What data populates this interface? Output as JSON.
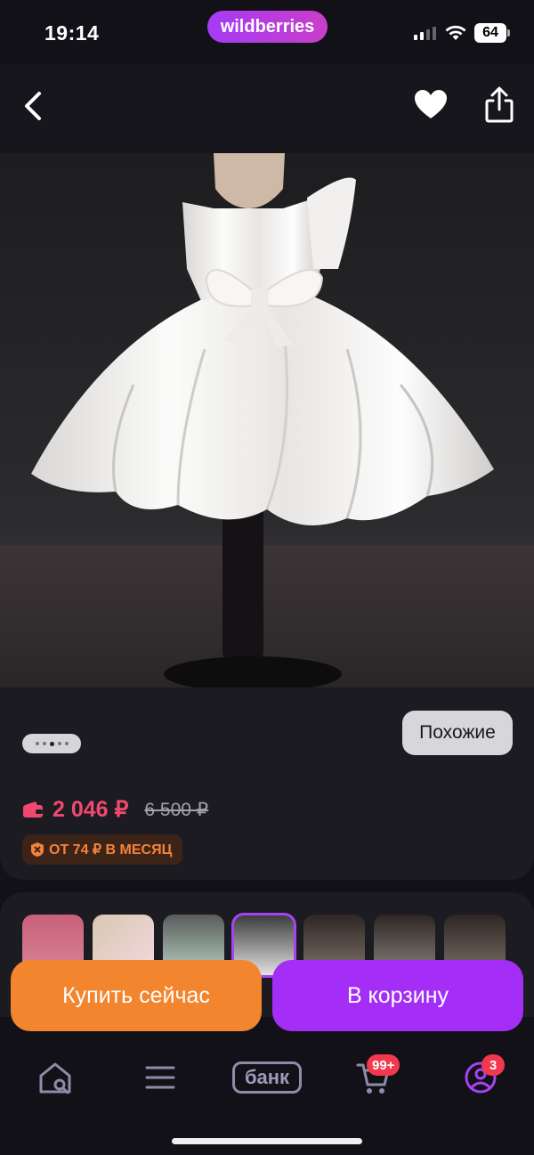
{
  "status_bar": {
    "time": "19:14",
    "brand": "wildberries",
    "battery": "64"
  },
  "top_nav": {
    "back_icon": "chevron-left-icon",
    "favorite_icon": "heart-icon",
    "share_icon": "share-icon"
  },
  "gallery": {
    "image_alt": "white satin girls dress with bow",
    "similar_button": "Похожие"
  },
  "pricing": {
    "price": "2 046 ₽",
    "old_price": "6 500 ₽",
    "installment": "ОТ 74 ₽ В МЕСЯЦ"
  },
  "variants": {
    "count": 7,
    "selected_index": 3
  },
  "actions": {
    "buy_now": "Купить сейчас",
    "add_to_cart": "В корзину"
  },
  "tab_bar": {
    "home_icon": "home-search-icon",
    "catalog_icon": "menu-icon",
    "bank_label": "банк",
    "cart_icon": "cart-icon",
    "cart_badge": "99+",
    "profile_icon": "profile-icon",
    "profile_badge": "3"
  },
  "colors": {
    "accent_purple": "#a42ef5",
    "accent_orange": "#f2852d",
    "price_pink": "#f0496f",
    "badge_red": "#f2384f"
  }
}
